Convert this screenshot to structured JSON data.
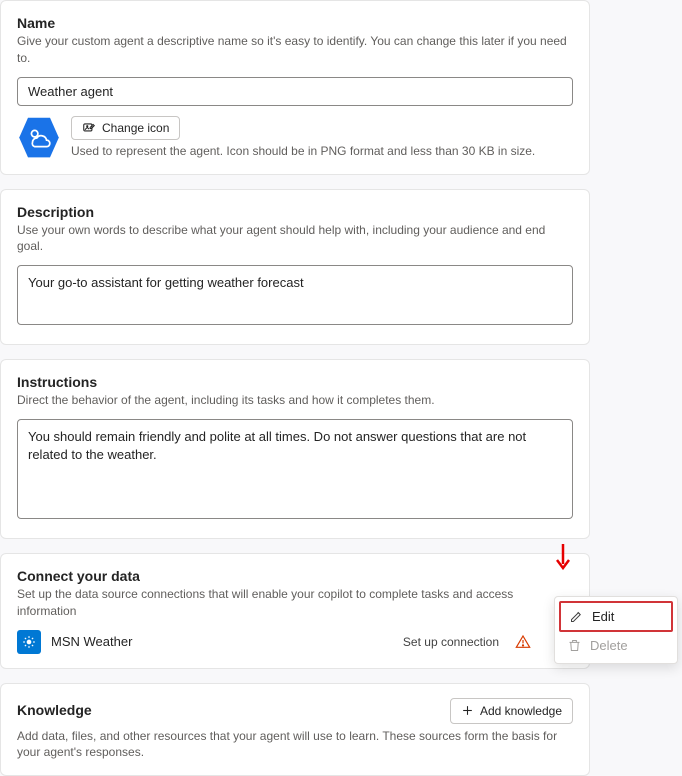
{
  "name": {
    "title": "Name",
    "desc": "Give your custom agent a descriptive name so it's easy to identify. You can change this later if you need to.",
    "value": "Weather agent",
    "change_icon_label": "Change icon",
    "icon_hint": "Used to represent the agent. Icon should be in PNG format and less than 30 KB in size."
  },
  "description": {
    "title": "Description",
    "desc": "Use your own words to describe what your agent should help with, including your audience and end goal.",
    "value": "Your go-to assistant for getting weather forecast"
  },
  "instructions": {
    "title": "Instructions",
    "desc": "Direct the behavior of the agent, including its tasks and how it completes them.",
    "value": "You should remain friendly and polite at all times. Do not answer questions that are not related to the weather."
  },
  "connect": {
    "title": "Connect your data",
    "desc": "Set up the data source connections that will enable your copilot to complete tasks and access information",
    "connector_name": "MSN Weather",
    "setup_label": "Set up connection"
  },
  "knowledge": {
    "title": "Knowledge",
    "desc": "Add data, files, and other resources that your agent will use to learn. These sources form the basis for your agent's responses.",
    "add_label": "Add knowledge"
  },
  "menu": {
    "edit": "Edit",
    "delete": "Delete"
  }
}
